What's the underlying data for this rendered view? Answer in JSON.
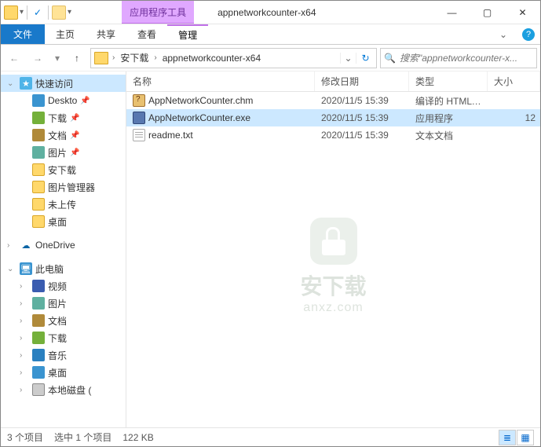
{
  "titlebar": {
    "context_tool": "应用程序工具",
    "title": "appnetworkcounter-x64"
  },
  "ribbon": {
    "file": "文件",
    "tabs": [
      "主页",
      "共享",
      "查看"
    ],
    "context_tab": "管理"
  },
  "address": {
    "crumbs": [
      "安下载",
      "appnetworkcounter-x64"
    ],
    "search_placeholder": "搜索\"appnetworkcounter-x..."
  },
  "tree": {
    "quick_access": "快速访问",
    "quick_items": [
      {
        "label": "Deskto",
        "icon": "ico-desktop",
        "pin": true
      },
      {
        "label": "下载",
        "icon": "ico-dl",
        "pin": true
      },
      {
        "label": "文档",
        "icon": "ico-doc",
        "pin": true
      },
      {
        "label": "图片",
        "icon": "ico-pic",
        "pin": true
      },
      {
        "label": "安下载",
        "icon": "ico-folder",
        "pin": false
      },
      {
        "label": "图片管理器",
        "icon": "ico-folder",
        "pin": false
      },
      {
        "label": "未上传",
        "icon": "ico-folder",
        "pin": false
      },
      {
        "label": "桌面",
        "icon": "ico-folder",
        "pin": false
      }
    ],
    "onedrive": "OneDrive",
    "this_pc": "此电脑",
    "pc_items": [
      {
        "label": "视频",
        "icon": "ico-video"
      },
      {
        "label": "图片",
        "icon": "ico-pic"
      },
      {
        "label": "文档",
        "icon": "ico-doc"
      },
      {
        "label": "下载",
        "icon": "ico-dl"
      },
      {
        "label": "音乐",
        "icon": "ico-music"
      },
      {
        "label": "桌面",
        "icon": "ico-desktop"
      },
      {
        "label": "本地磁盘 (",
        "icon": "ico-disk"
      }
    ]
  },
  "columns": {
    "name": "名称",
    "date": "修改日期",
    "type": "类型",
    "size": "大小"
  },
  "files": [
    {
      "name": "AppNetworkCounter.chm",
      "date": "2020/11/5 15:39",
      "type": "编译的 HTML 帮...",
      "size": "",
      "ico": "chm",
      "selected": false
    },
    {
      "name": "AppNetworkCounter.exe",
      "date": "2020/11/5 15:39",
      "type": "应用程序",
      "size": "12",
      "ico": "exe",
      "selected": true
    },
    {
      "name": "readme.txt",
      "date": "2020/11/5 15:39",
      "type": "文本文档",
      "size": "",
      "ico": "txt",
      "selected": false
    }
  ],
  "watermark": {
    "text": "安下载",
    "sub": "anxz.com"
  },
  "status": {
    "count": "3 个项目",
    "selection": "选中 1 个项目",
    "size": "122 KB"
  }
}
